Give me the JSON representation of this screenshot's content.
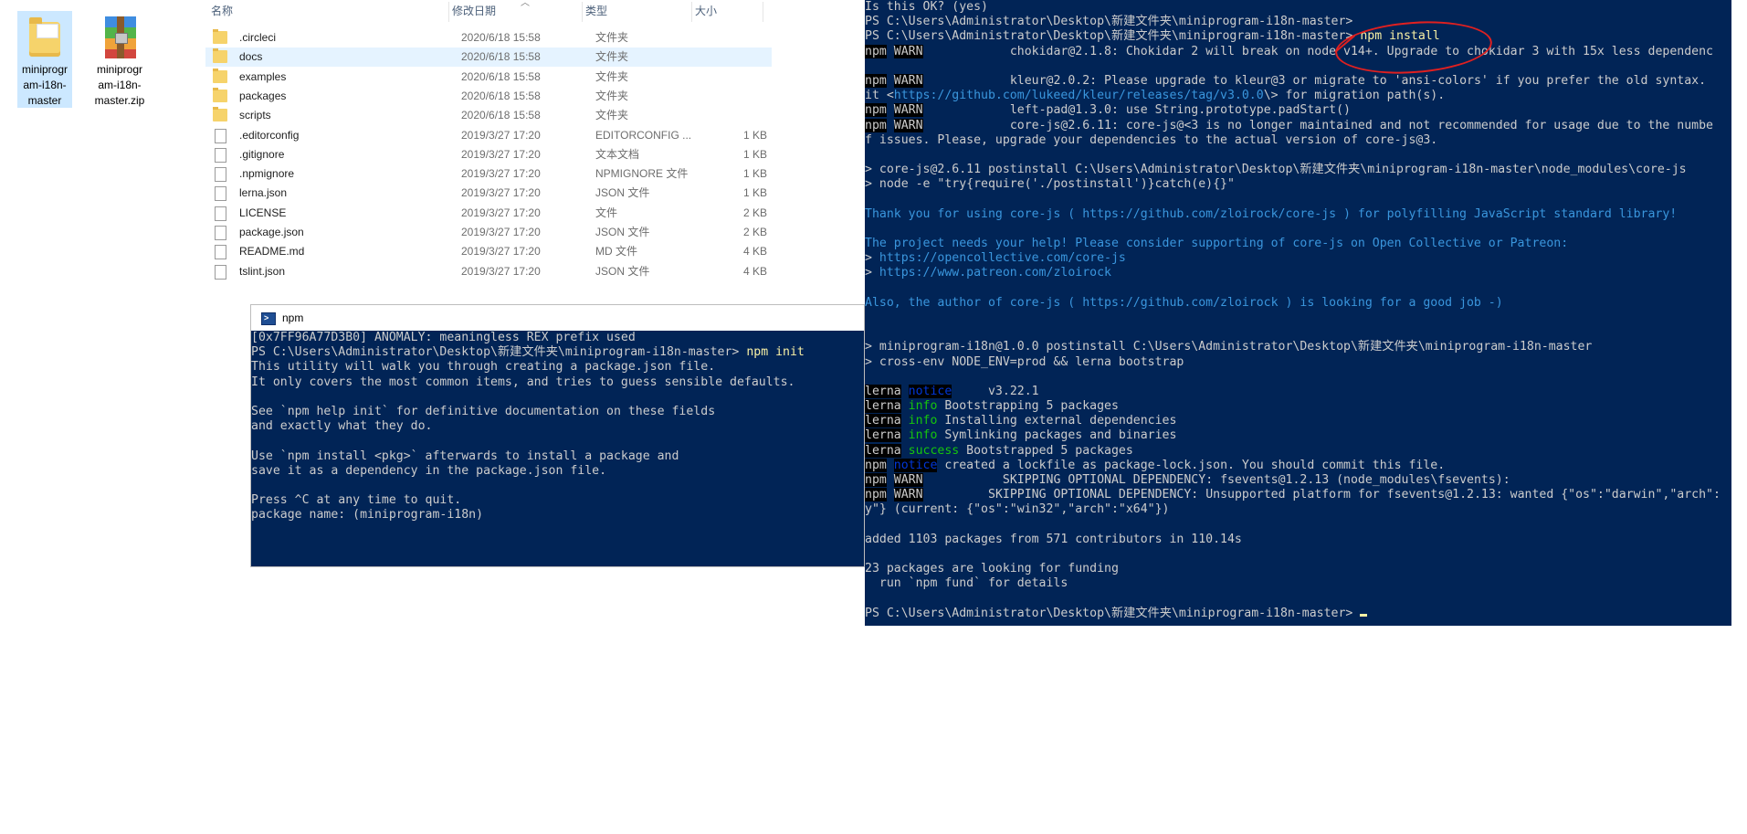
{
  "desktop": {
    "icons": [
      {
        "label": "miniprogram-i18n-master"
      },
      {
        "label": "miniprogram-i18n-master.zip"
      }
    ]
  },
  "explorer": {
    "columns": {
      "name": "名称",
      "date": "修改日期",
      "type": "类型",
      "size": "大小"
    },
    "rows": [
      {
        "name": ".circleci",
        "date": "2020/6/18 15:58",
        "type": "文件夹",
        "size": "",
        "kind": "folder"
      },
      {
        "name": "docs",
        "date": "2020/6/18 15:58",
        "type": "文件夹",
        "size": "",
        "kind": "folder"
      },
      {
        "name": "examples",
        "date": "2020/6/18 15:58",
        "type": "文件夹",
        "size": "",
        "kind": "folder"
      },
      {
        "name": "packages",
        "date": "2020/6/18 15:58",
        "type": "文件夹",
        "size": "",
        "kind": "folder"
      },
      {
        "name": "scripts",
        "date": "2020/6/18 15:58",
        "type": "文件夹",
        "size": "",
        "kind": "folder"
      },
      {
        "name": ".editorconfig",
        "date": "2019/3/27 17:20",
        "type": "EDITORCONFIG ...",
        "size": "1 KB",
        "kind": "file"
      },
      {
        "name": ".gitignore",
        "date": "2019/3/27 17:20",
        "type": "文本文档",
        "size": "1 KB",
        "kind": "file"
      },
      {
        "name": ".npmignore",
        "date": "2019/3/27 17:20",
        "type": "NPMIGNORE 文件",
        "size": "1 KB",
        "kind": "file"
      },
      {
        "name": "lerna.json",
        "date": "2019/3/27 17:20",
        "type": "JSON 文件",
        "size": "1 KB",
        "kind": "file"
      },
      {
        "name": "LICENSE",
        "date": "2019/3/27 17:20",
        "type": "文件",
        "size": "2 KB",
        "kind": "file"
      },
      {
        "name": "package.json",
        "date": "2019/3/27 17:20",
        "type": "JSON 文件",
        "size": "2 KB",
        "kind": "file"
      },
      {
        "name": "README.md",
        "date": "2019/3/27 17:20",
        "type": "MD 文件",
        "size": "4 KB",
        "kind": "file"
      },
      {
        "name": "tslint.json",
        "date": "2019/3/27 17:20",
        "type": "JSON 文件",
        "size": "4 KB",
        "kind": "file"
      }
    ]
  },
  "npm_window": {
    "title": "npm",
    "lines": [
      "[0x7FF96A77D3B0] ANOMALY: meaningless REX prefix used",
      "PS C:\\Users\\Administrator\\Desktop\\新建文件夹\\miniprogram-i18n-master> npm init",
      "This utility will walk you through creating a package.json file.",
      "It only covers the most common items, and tries to guess sensible defaults.",
      "",
      "See `npm help init` for definitive documentation on these fields",
      "and exactly what they do.",
      "",
      "Use `npm install <pkg>` afterwards to install a package and",
      "save it as a dependency in the package.json file.",
      "",
      "Press ^C at any time to quit.",
      "package name: (miniprogram-i18n)"
    ]
  },
  "main_terminal": {
    "lines": [
      "Is this OK? (yes)",
      "PS C:\\Users\\Administrator\\Desktop\\新建文件夹\\miniprogram-i18n-master>",
      "PS C:\\Users\\Administrator\\Desktop\\新建文件夹\\miniprogram-i18n-master> npm install",
      "npm WARN            chokidar@2.1.8: Chokidar 2 will break on node v14+. Upgrade to chokidar 3 with 15x less dependenc",
      "",
      "npm WARN            kleur@2.0.2: Please upgrade to kleur@3 or migrate to 'ansi-colors' if you prefer the old syntax.",
      "it <https://github.com/lukeed/kleur/releases/tag/v3.0.0\\> for migration path(s).",
      "npm WARN            left-pad@1.3.0: use String.prototype.padStart()",
      "npm WARN            core-js@2.6.11: core-js@<3 is no longer maintained and not recommended for usage due to the numbe",
      "f issues. Please, upgrade your dependencies to the actual version of core-js@3.",
      "",
      "> core-js@2.6.11 postinstall C:\\Users\\Administrator\\Desktop\\新建文件夹\\miniprogram-i18n-master\\node_modules\\core-js",
      "> node -e \"try{require('./postinstall')}catch(e){}\"",
      "",
      "Thank you for using core-js ( https://github.com/zloirock/core-js ) for polyfilling JavaScript standard library!",
      "",
      "The project needs your help! Please consider supporting of core-js on Open Collective or Patreon:",
      "> https://opencollective.com/core-js",
      "> https://www.patreon.com/zloirock",
      "",
      "Also, the author of core-js ( https://github.com/zloirock ) is looking for a good job -)",
      "",
      "",
      "> miniprogram-i18n@1.0.0 postinstall C:\\Users\\Administrator\\Desktop\\新建文件夹\\miniprogram-i18n-master",
      "> cross-env NODE_ENV=prod && lerna bootstrap",
      "",
      "lerna notice     v3.22.1",
      "lerna info Bootstrapping 5 packages",
      "lerna info Installing external dependencies",
      "lerna info Symlinking packages and binaries",
      "lerna success Bootstrapped 5 packages",
      "npm notice created a lockfile as package-lock.json. You should commit this file.",
      "npm WARN           SKIPPING OPTIONAL DEPENDENCY: fsevents@1.2.13 (node_modules\\fsevents):",
      "npm WARN         SKIPPING OPTIONAL DEPENDENCY: Unsupported platform for fsevents@1.2.13: wanted {\"os\":\"darwin\",\"arch\":",
      "y\"} (current: {\"os\":\"win32\",\"arch\":\"x64\"})",
      "",
      "added 1103 packages from 571 contributors in 110.14s",
      "",
      "23 packages are looking for funding",
      "  run `npm fund` for details",
      "",
      "PS C:\\Users\\Administrator\\Desktop\\新建文件夹\\miniprogram-i18n-master> "
    ]
  },
  "colors": {
    "terminal_bg": "#012456",
    "terminal_fg": "#cccccc",
    "link": "#3a96dd",
    "info_green": "#16c60c",
    "annotation_red": "#e02020",
    "selection": "#e5f3ff"
  }
}
